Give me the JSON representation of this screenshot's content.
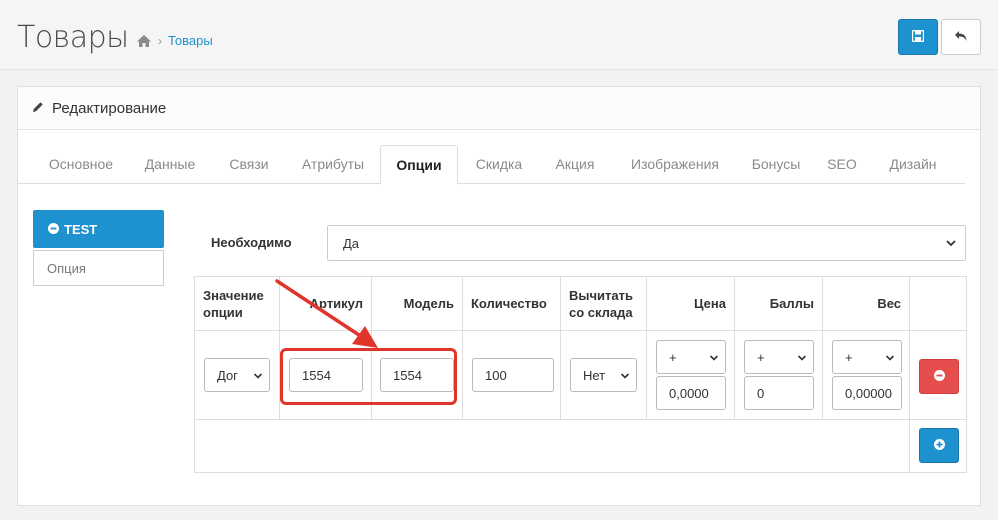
{
  "header": {
    "title": "Товары",
    "breadcrumb_link": "Товары",
    "breadcrumb_sep": "›"
  },
  "panel": {
    "heading": "Редактирование"
  },
  "tabs": [
    {
      "label": "Основное"
    },
    {
      "label": "Данные"
    },
    {
      "label": "Связи"
    },
    {
      "label": "Атрибуты"
    },
    {
      "label": "Опции",
      "active": true
    },
    {
      "label": "Скидка"
    },
    {
      "label": "Акция"
    },
    {
      "label": "Изображения"
    },
    {
      "label": "Бонусы"
    },
    {
      "label": "SEO"
    },
    {
      "label": "Дизайн"
    }
  ],
  "options_sidebar": {
    "active_option": "TEST",
    "option_placeholder": "Опция"
  },
  "required": {
    "label": "Необходимо",
    "value": "Да"
  },
  "table": {
    "columns": [
      "Значение опции",
      "Артикул",
      "Модель",
      "Количество",
      "Вычитать со склада",
      "Цена",
      "Баллы",
      "Вес"
    ],
    "row": {
      "value_select": "Дог",
      "article": "1554",
      "model": "1554",
      "quantity": "100",
      "subtract": "Нет",
      "price_prefix": "+",
      "price": "0,0000",
      "points_prefix": "+",
      "points": "0",
      "weight_prefix": "+",
      "weight": "0,00000"
    }
  },
  "colors": {
    "primary": "#1e91cf",
    "danger": "#e64d4d",
    "annotation": "#e0352b"
  },
  "icons": {
    "save": "save-icon",
    "back": "reply-icon",
    "home": "home-icon",
    "pencil": "pencil-icon",
    "minus": "minus-circle-icon",
    "plus": "plus-circle-icon"
  }
}
